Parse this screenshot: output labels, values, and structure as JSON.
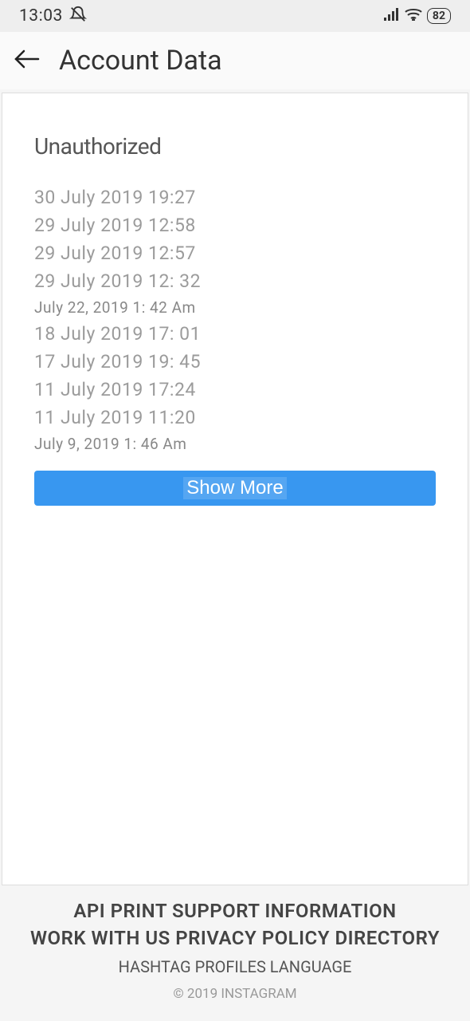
{
  "status_bar": {
    "time": "13:03",
    "battery_level": "82"
  },
  "header": {
    "title": "Account Data"
  },
  "content": {
    "section_title": "Unauthorized",
    "dates": [
      {
        "text": "30 July 2019 19:27",
        "small": false
      },
      {
        "text": "29 July 2019 12:58",
        "small": false
      },
      {
        "text": "29 July 2019 12:57",
        "small": false
      },
      {
        "text": "29 July 2019 12: 32",
        "small": false
      },
      {
        "text": "July 22, 2019 1: 42 Am",
        "small": true
      },
      {
        "text": "18 July 2019 17: 01",
        "small": false
      },
      {
        "text": "17 July 2019 19: 45",
        "small": false
      },
      {
        "text": "11 July 2019 17:24",
        "small": false
      },
      {
        "text": "11 July 2019 11:20",
        "small": false
      },
      {
        "text": "July 9, 2019 1: 46 Am",
        "small": true
      }
    ],
    "show_more_label": "Show More"
  },
  "footer": {
    "links_row_1": "API PRINT SUPPORT INFORMATION",
    "links_row_2": "WORK WITH US PRIVACY POLICY DIRECTORY",
    "links_row_3": "HASHTAG PROFILES LANGUAGE",
    "copyright": "© 2019 INSTAGRAM"
  }
}
